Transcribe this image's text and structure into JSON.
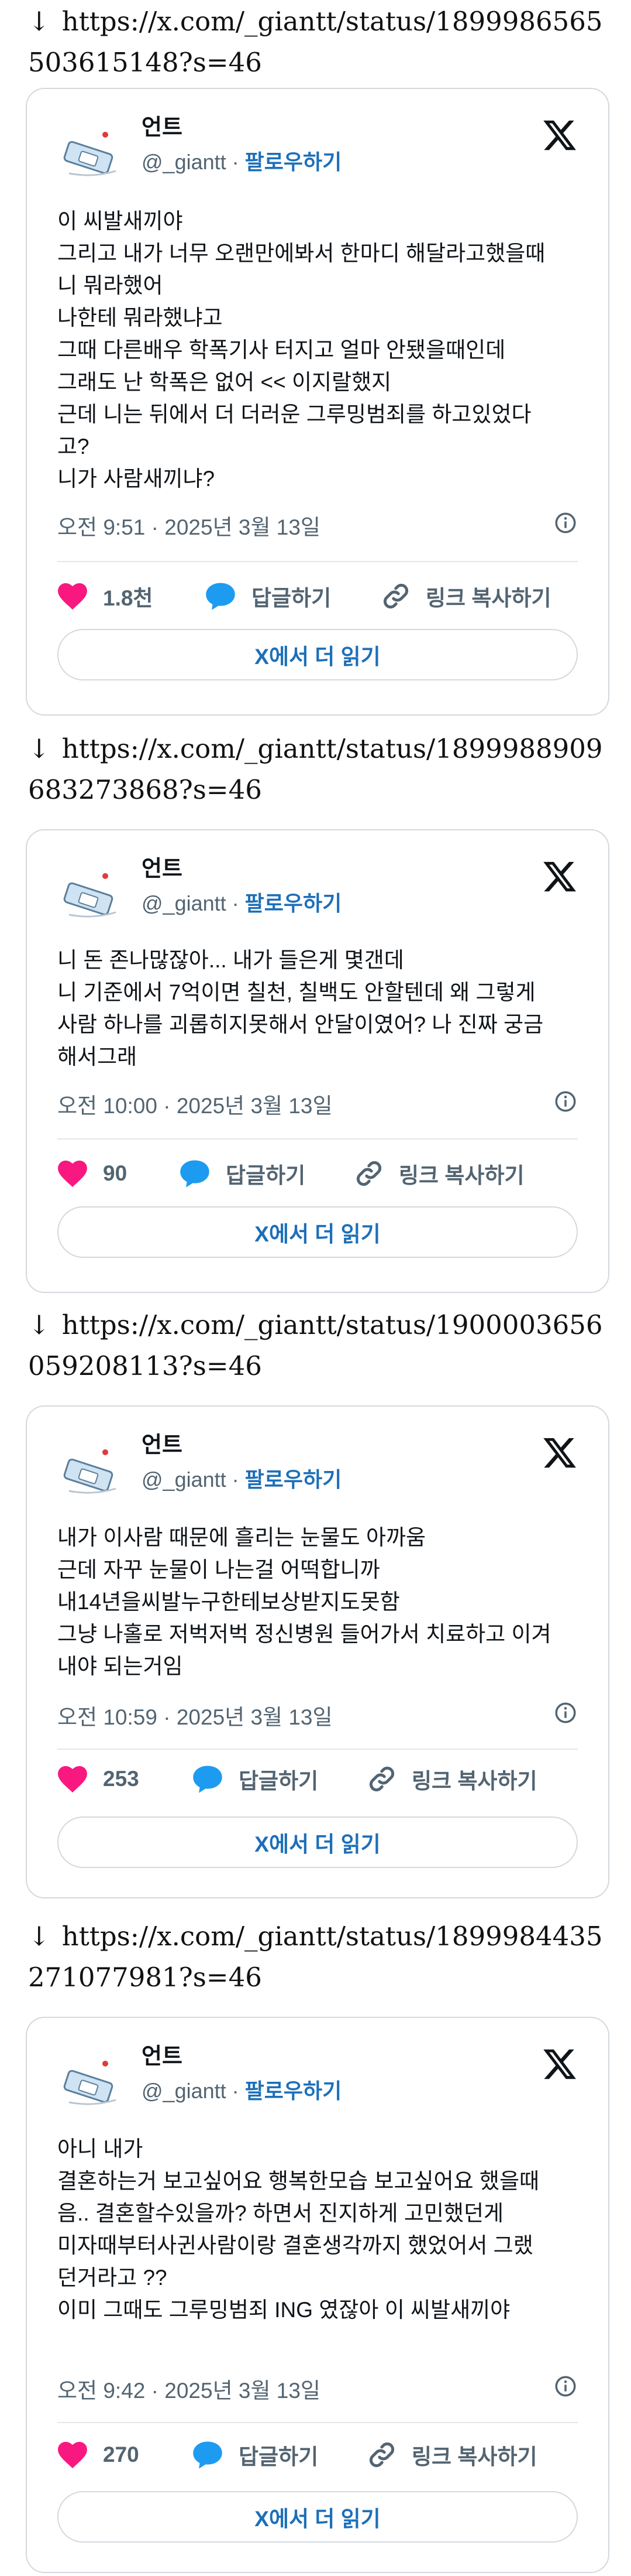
{
  "colors": {
    "link": "#1d6fb8",
    "heart": "#f91880",
    "reply": "#1d9bf0",
    "muted": "#536471",
    "border": "#d3d9de"
  },
  "posts": [
    {
      "url": "https://x.com/_giantt/status/1899986565503615148?s=46",
      "name": "언트",
      "handle": "@_giantt",
      "follow": "팔로우하기",
      "text": "이 씨발새끼야\n그리고 내가 너무 오랜만에봐서 한마디 해달라고했을때\n니 뭐라했어\n나한테 뭐라했냐고\n그때 다른배우 학폭기사 터지고 얼마 안됐을때인데\n그래도 난 학폭은 없어 << 이지랄했지\n근데 니는 뒤에서 더 더러운 그루밍범죄를 하고있었다\n고?\n니가 사람새끼냐?",
      "time": "오전 9:51 · 2025년 3월 13일",
      "likes": "1.8천",
      "reply_label": "답글하기",
      "copy_label": "링크 복사하기",
      "read_more": "X에서 더 읽기"
    },
    {
      "url": "https://x.com/_giantt/status/1899988909683273868?s=46",
      "name": "언트",
      "handle": "@_giantt",
      "follow": "팔로우하기",
      "text": "니 돈 존나많잖아... 내가 들은게 몇갠데\n니 기준에서 7억이면 칠천, 칠백도 안할텐데 왜 그렇게\n사람 하나를 괴롭히지못해서 안달이였어? 나 진짜 궁금\n해서그래",
      "time": "오전 10:00 · 2025년 3월 13일",
      "likes": "90",
      "reply_label": "답글하기",
      "copy_label": "링크 복사하기",
      "read_more": "X에서 더 읽기"
    },
    {
      "url": "https://x.com/_giantt/status/1900003656059208113?s=46",
      "name": "언트",
      "handle": "@_giantt",
      "follow": "팔로우하기",
      "text": "내가 이사람 때문에 흘리는 눈물도 아까움\n근데 자꾸 눈물이 나는걸 어떡합니까\n내14년을씨발누구한테보상받지도못함\n그냥 나홀로 저벅저벅 정신병원 들어가서 치료하고 이겨\n내야 되는거임",
      "time": "오전 10:59 · 2025년 3월 13일",
      "likes": "253",
      "reply_label": "답글하기",
      "copy_label": "링크 복사하기",
      "read_more": "X에서 더 읽기"
    },
    {
      "url": "https://x.com/_giantt/status/1899984435271077981?s=46",
      "name": "언트",
      "handle": "@_giantt",
      "follow": "팔로우하기",
      "text": "아니 내가\n결혼하는거 보고싶어요 행복한모습 보고싶어요 했을때\n음.. 결혼할수있을까? 하면서 진지하게 고민했던게\n미자때부터사귄사람이랑 결혼생각까지 했었어서 그랬\n던거라고 ??\n이미 그때도 그루밍범죄 ING 였잖아 이 씨발새끼야",
      "time": "오전 9:42 · 2025년 3월 13일",
      "likes": "270",
      "reply_label": "답글하기",
      "copy_label": "링크 복사하기",
      "read_more": "X에서 더 읽기"
    }
  ]
}
